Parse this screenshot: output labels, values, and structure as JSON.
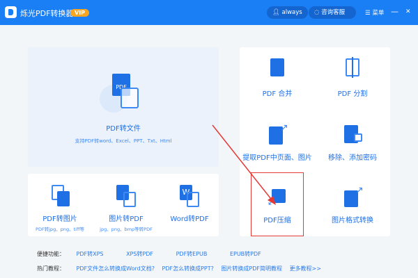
{
  "titlebar": {
    "app_name": "烁光PDF转换器",
    "vip": "VIP",
    "user": "always",
    "service": "咨询客服",
    "menu": "菜单",
    "minimize": "—",
    "close": "✕"
  },
  "main": {
    "title": "PDF转文件",
    "subtitle": "支持PDF转word、Excel、PPT、Txt、Html",
    "icon_text": "PDF"
  },
  "bottom_tiles": [
    {
      "label": "PDF转图片",
      "sub": "PDF转jpg、png、tiff等"
    },
    {
      "label": "图片转PDF",
      "sub": "jpg、png、bmp等转PDF"
    },
    {
      "label": "Word转PDF",
      "sub": ""
    }
  ],
  "right_tiles": [
    {
      "label": "PDF 合并"
    },
    {
      "label": "PDF 分割"
    },
    {
      "label": "提取PDF中页面、图片"
    },
    {
      "label": "移除、添加密码"
    },
    {
      "label": "PDF压缩"
    },
    {
      "label": "图片格式转换"
    }
  ],
  "quick": {
    "label": "便捷功能：",
    "items": [
      "PDF转XPS",
      "XPS转PDF",
      "PDF转EPUB",
      "EPUB转PDF"
    ]
  },
  "hot": {
    "label": "热门教程：",
    "items": [
      "PDF文件怎么转换成Word文档?",
      "PDF怎么转换成PPT?",
      "图片转换成PDF简明教程",
      "更多教程>>"
    ]
  },
  "colors": {
    "primary": "#1a7ef5",
    "highlight": "#e53935"
  }
}
